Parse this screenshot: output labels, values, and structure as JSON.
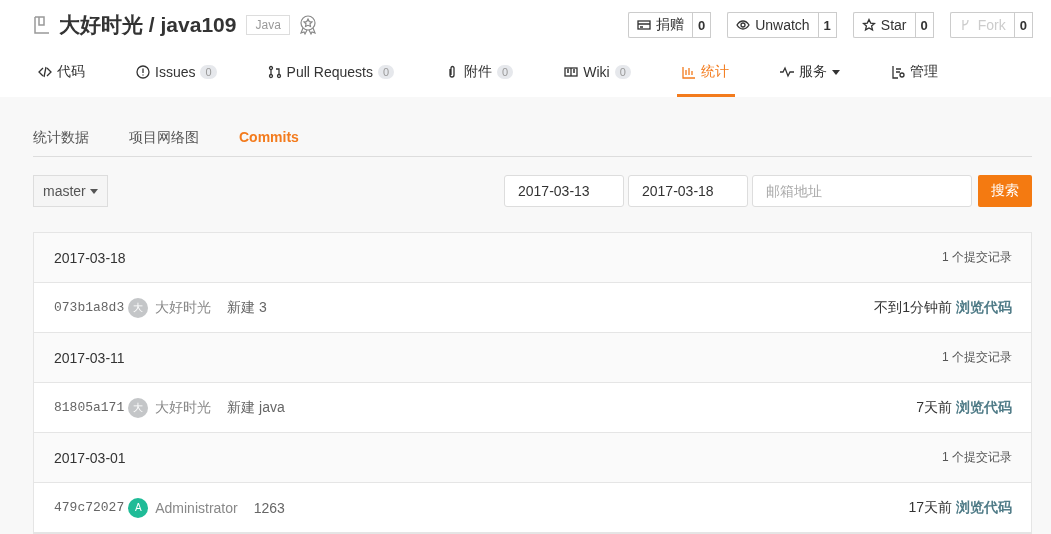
{
  "repo": {
    "owner": "大好时光",
    "separator": "/",
    "name": "java109",
    "language": "Java"
  },
  "actions": [
    {
      "kind": "donate",
      "label": "捐赠",
      "count": "0",
      "disabled": false
    },
    {
      "kind": "watch",
      "label": "Unwatch",
      "count": "1",
      "disabled": false
    },
    {
      "kind": "star",
      "label": "Star",
      "count": "0",
      "disabled": false
    },
    {
      "kind": "fork",
      "label": "Fork",
      "count": "0",
      "disabled": true
    }
  ],
  "tabs": [
    {
      "kind": "code",
      "label": "代码",
      "selected": false
    },
    {
      "kind": "issues",
      "label": "Issues",
      "count": "0",
      "selected": false
    },
    {
      "kind": "pull",
      "label": "Pull Requests",
      "count": "0",
      "selected": false
    },
    {
      "kind": "attach",
      "label": "附件",
      "count": "0",
      "selected": false
    },
    {
      "kind": "wiki",
      "label": "Wiki",
      "count": "0",
      "selected": false
    },
    {
      "kind": "stats",
      "label": "统计",
      "selected": true
    },
    {
      "kind": "service",
      "label": "服务",
      "dropdown": true,
      "selected": false
    },
    {
      "kind": "manage",
      "label": "管理",
      "selected": false
    }
  ],
  "subtabs": [
    {
      "label": "统计数据",
      "selected": false
    },
    {
      "label": "项目网络图",
      "selected": false
    },
    {
      "label": "Commits",
      "selected": true
    }
  ],
  "branch": "master",
  "filters": {
    "from": "2017-03-13",
    "to": "2017-03-18",
    "email_placeholder": "邮箱地址",
    "search": "搜索"
  },
  "groups": [
    {
      "date": "2017-03-18",
      "summary": "1 个提交记录",
      "commits": [
        {
          "sha": "073b1a8d3",
          "avatar": "大",
          "color": "#c4c6c8",
          "author": "大好时光",
          "message": "新建 3",
          "time": "不到1分钟前",
          "link": "浏览代码"
        }
      ]
    },
    {
      "date": "2017-03-11",
      "summary": "1 个提交记录",
      "commits": [
        {
          "sha": "81805a171",
          "avatar": "大",
          "color": "#c4c6c8",
          "author": "大好时光",
          "message": "新建 java",
          "time": "7天前",
          "link": "浏览代码"
        }
      ]
    },
    {
      "date": "2017-03-01",
      "summary": "1 个提交记录",
      "commits": [
        {
          "sha": "479c72027",
          "avatar": "A",
          "color": "#1fbb97",
          "author": "Administrator",
          "message": "1263",
          "time": "17天前",
          "link": "浏览代码"
        }
      ]
    }
  ]
}
